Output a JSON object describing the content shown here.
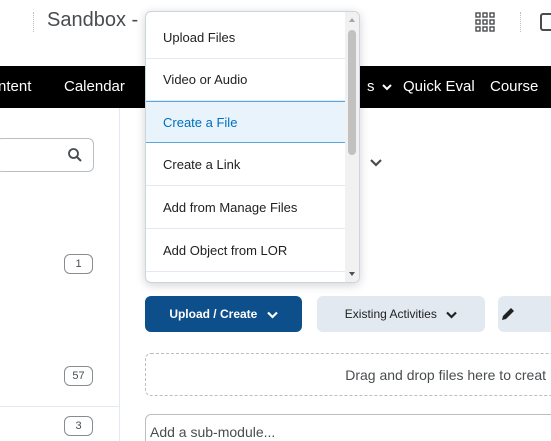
{
  "header": {
    "title": "Sandbox -",
    "apps_icon": "grid-icon"
  },
  "nav": {
    "items": [
      "ntent",
      "Calendar",
      "s",
      "Quick Eval",
      "Course"
    ]
  },
  "left": {
    "search_icon": "search-icon",
    "badges": [
      "1",
      "57",
      "3"
    ]
  },
  "dropdown": {
    "items": [
      "Upload Files",
      "Video or Audio",
      "Create a File",
      "Create a Link",
      "Add from Manage Files",
      "Add Object from LOR"
    ],
    "active_index": 2
  },
  "toolbar": {
    "upload_create_label": "Upload / Create",
    "existing_activities_label": "Existing Activities"
  },
  "dropzone": {
    "text": "Drag and drop files here to creat"
  },
  "submodule": {
    "placeholder": "Add a sub-module..."
  },
  "colors": {
    "primary": "#0d4f8b",
    "nav_bg": "#000000",
    "active_bg": "#e8f3fb",
    "active_text": "#006fbf"
  }
}
